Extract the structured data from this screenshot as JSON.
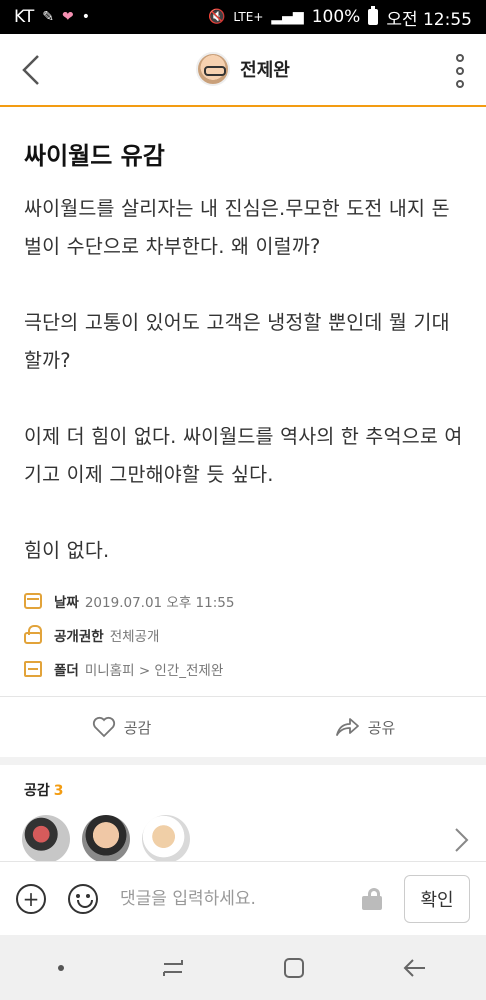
{
  "status_bar": {
    "carrier": "KT",
    "network": "LTE+",
    "battery": "100%",
    "time": "오전 12:55"
  },
  "header": {
    "title": "전제완"
  },
  "post": {
    "title": "싸이월드 유감",
    "paragraphs": [
      "싸이월드를 살리자는 내 진심은.무모한 도전 내지 돈벌이 수단으로 차부한다. 왜 이럴까?",
      "극단의 고통이 있어도 고객은 냉정할 뿐인데 뭘 기대할까?",
      "이제 더 힘이 없다. 싸이월드를 역사의 한 추억으로 여기고 이제 그만해야할 듯 싶다.",
      "힘이 없다."
    ]
  },
  "meta": {
    "date_label": "날짜",
    "date_value": "2019.07.01 오후 11:55",
    "visibility_label": "공개권한",
    "visibility_value": "전체공개",
    "folder_label": "폴더",
    "folder_value": "미니홈피 > 인간_전제완"
  },
  "actions": {
    "like_label": "공감",
    "share_label": "공유"
  },
  "likes": {
    "label": "공감",
    "count": "3"
  },
  "comment": {
    "placeholder": "댓글을 입력하세요.",
    "confirm_label": "확인"
  },
  "colors": {
    "accent": "#f39c12",
    "icon_orange": "#e2a33a"
  }
}
